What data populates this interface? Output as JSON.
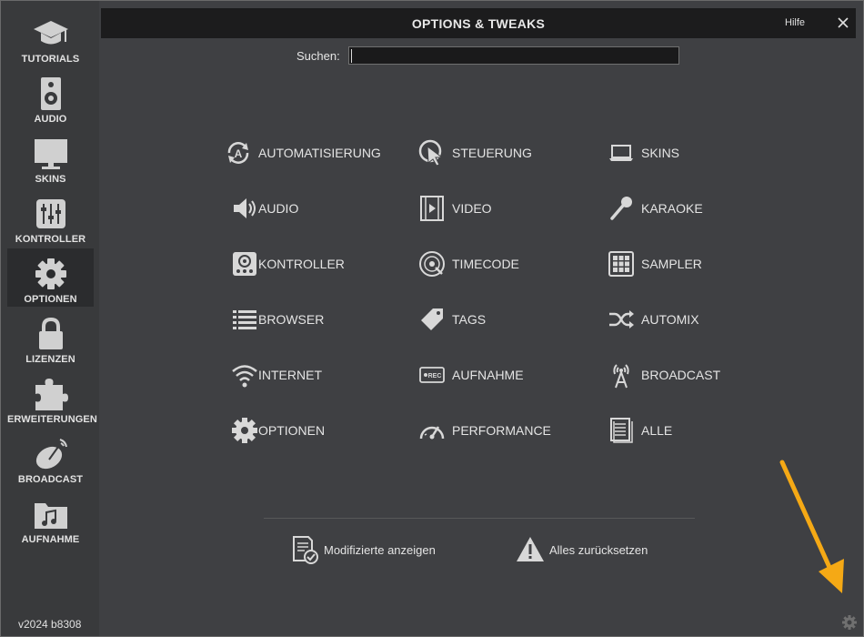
{
  "window": {
    "title": "OPTIONS & TWEAKS",
    "help_label": "Hilfe",
    "close_icon": "close-icon"
  },
  "sidebar": {
    "items": [
      {
        "label": "TUTORIALS",
        "icon": "graduation-cap-icon"
      },
      {
        "label": "AUDIO",
        "icon": "speaker-icon"
      },
      {
        "label": "SKINS",
        "icon": "monitor-icon"
      },
      {
        "label": "KONTROLLER",
        "icon": "mixer-sliders-icon"
      },
      {
        "label": "OPTIONEN",
        "icon": "gear-icon",
        "active": true
      },
      {
        "label": "LIZENZEN",
        "icon": "lock-icon"
      },
      {
        "label": "ERWEITERUNGEN",
        "icon": "puzzle-icon"
      },
      {
        "label": "BROADCAST",
        "icon": "satellite-dish-icon"
      },
      {
        "label": "AUFNAHME",
        "icon": "music-folder-icon"
      }
    ],
    "version": "v2024 b8308"
  },
  "search": {
    "label": "Suchen:",
    "value": ""
  },
  "options": [
    {
      "label": "AUTOMATISIERUNG",
      "icon": "automation-icon"
    },
    {
      "label": "STEUERUNG",
      "icon": "cursor-control-icon"
    },
    {
      "label": "SKINS",
      "icon": "laptop-icon"
    },
    {
      "label": "AUDIO",
      "icon": "volume-icon"
    },
    {
      "label": "VIDEO",
      "icon": "film-icon"
    },
    {
      "label": "KARAOKE",
      "icon": "microphone-icon"
    },
    {
      "label": "KONTROLLER",
      "icon": "controller-icon"
    },
    {
      "label": "TIMECODE",
      "icon": "vinyl-icon"
    },
    {
      "label": "SAMPLER",
      "icon": "sampler-grid-icon"
    },
    {
      "label": "BROWSER",
      "icon": "list-icon"
    },
    {
      "label": "TAGS",
      "icon": "tag-icon"
    },
    {
      "label": "AUTOMIX",
      "icon": "shuffle-icon"
    },
    {
      "label": "INTERNET",
      "icon": "wifi-icon"
    },
    {
      "label": "AUFNAHME",
      "icon": "rec-icon"
    },
    {
      "label": "BROADCAST",
      "icon": "antenna-icon"
    },
    {
      "label": "OPTIONEN",
      "icon": "gear-icon"
    },
    {
      "label": "PERFORMANCE",
      "icon": "gauge-icon"
    },
    {
      "label": "ALLE",
      "icon": "document-icon"
    }
  ],
  "actions": {
    "show_modified": "Modifizierte anzeigen",
    "reset_all": "Alles zurücksetzen"
  },
  "colors": {
    "background": "#3f4043",
    "titlebar": "#1c1c1d",
    "annotation_arrow": "#f5a915"
  }
}
